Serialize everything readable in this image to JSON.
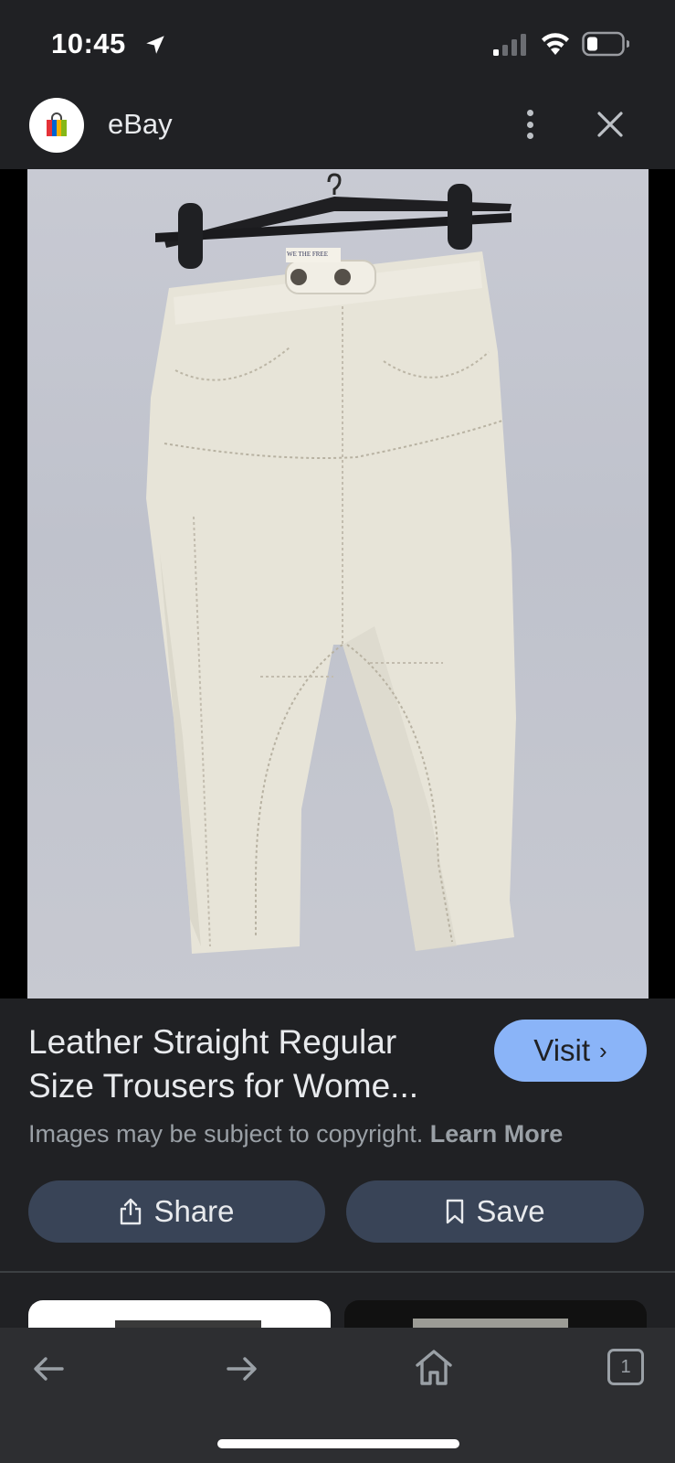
{
  "status_bar": {
    "time": "10:45"
  },
  "header": {
    "site_name": "eBay"
  },
  "result": {
    "title_line1": "Leather Straight Regular",
    "title_line2": "Size Trousers for Wome...",
    "visit_label": "Visit",
    "copyright_text": "Images may be subject to copyright.",
    "learn_more_label": "Learn More",
    "image_brand_label": "WE THE FREE"
  },
  "actions": {
    "share_label": "Share",
    "save_label": "Save"
  },
  "toolbar": {
    "tab_count": "1"
  },
  "colors": {
    "background": "#202124",
    "visit_button": "#8ab4f8",
    "action_button": "#394457",
    "toolbar": "#2d2e31"
  },
  "icons": [
    "location-arrow-icon",
    "signal-icon",
    "wifi-icon",
    "battery-icon",
    "ebay-bag-icon",
    "more-vert-icon",
    "close-icon",
    "share-icon",
    "bookmark-icon",
    "back-arrow-icon",
    "forward-arrow-icon",
    "home-icon",
    "tabs-icon"
  ]
}
